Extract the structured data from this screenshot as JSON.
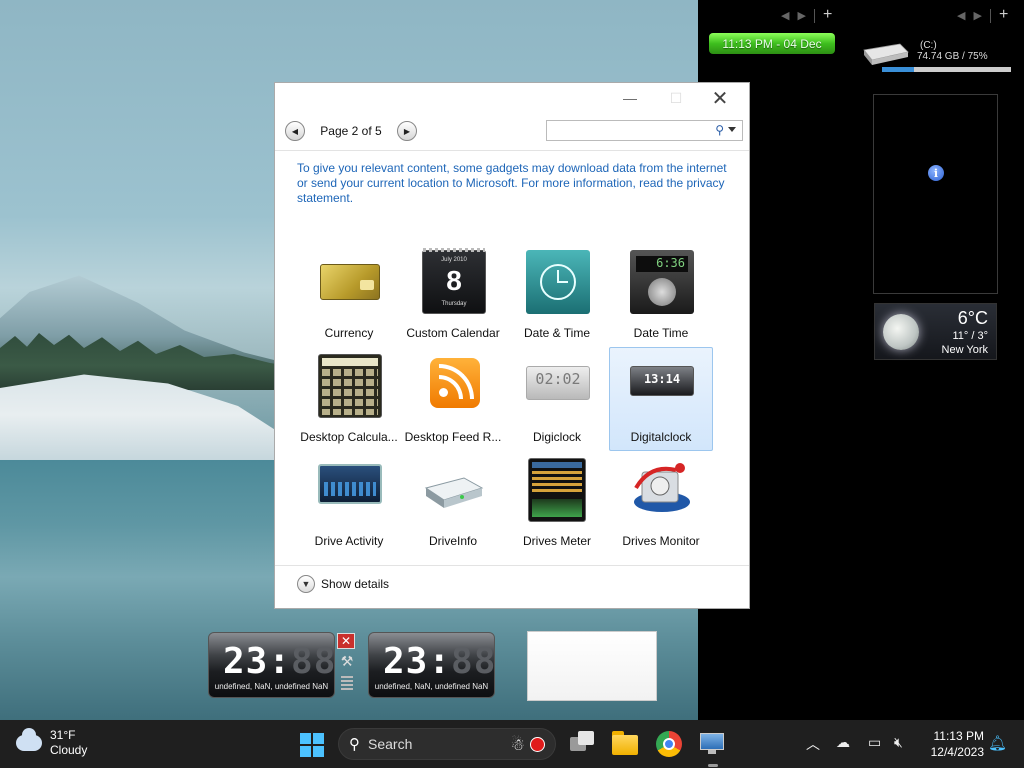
{
  "sidebar": {
    "clock_text": "11:13 PM - 04 Dec",
    "drive": {
      "label": "(C:)",
      "size": "74.74 GB / 75%",
      "used_fraction": 0.25
    },
    "info_glyph": "i",
    "weather": {
      "temp": "6°C",
      "range": "11° / 3°",
      "city": "New York"
    }
  },
  "gallery": {
    "page_label": "Page 2 of 5",
    "search_placeholder": "",
    "notice": "To give you relevant content, some gadgets may download data from the internet or send your current location to Microsoft. For more information, read the privacy statement.",
    "gadgets": [
      {
        "name": "Currency",
        "icon": "currency-icon",
        "selected": false
      },
      {
        "name": "Custom Calendar",
        "icon": "calendar-icon",
        "selected": false
      },
      {
        "name": "Date & Time",
        "icon": "clock-icon",
        "selected": false
      },
      {
        "name": "Date Time",
        "icon": "digital-date-time-icon",
        "selected": false
      },
      {
        "name": "Desktop Calcula...",
        "icon": "calculator-icon",
        "selected": false
      },
      {
        "name": "Desktop Feed R...",
        "icon": "rss-icon",
        "selected": false
      },
      {
        "name": "Digiclock",
        "icon": "digiclock-icon",
        "selected": false
      },
      {
        "name": "Digitalclock",
        "icon": "digitalclock-icon",
        "selected": true
      },
      {
        "name": "Drive Activity",
        "icon": "drive-activity-icon",
        "selected": false
      },
      {
        "name": "DriveInfo",
        "icon": "drive-icon",
        "selected": false
      },
      {
        "name": "Drives Meter",
        "icon": "drives-meter-icon",
        "selected": false
      },
      {
        "name": "Drives Monitor",
        "icon": "drives-monitor-icon",
        "selected": false
      }
    ],
    "calendar_icon": {
      "month": "July 2010",
      "day": "8",
      "weekday": "Thursday"
    },
    "digiclock_icon_time": "02:02",
    "show_details": "Show details"
  },
  "desktop_clocks": [
    {
      "digits": "23:",
      "dim_digits": "88",
      "date": "undefined, NaN, undefined NaN"
    },
    {
      "digits": "23:",
      "dim_digits": "88",
      "date": "undefined, NaN, undefined NaN"
    }
  ],
  "taskbar": {
    "weather_temp": "31°F",
    "weather_desc": "Cloudy",
    "search_label": "Search",
    "time": "11:13 PM",
    "date": "12/4/2023"
  },
  "colors": {
    "accent": "#1e66b8",
    "sidebar_clock": "#3ebf1e",
    "selection": "#d2e6fb"
  }
}
